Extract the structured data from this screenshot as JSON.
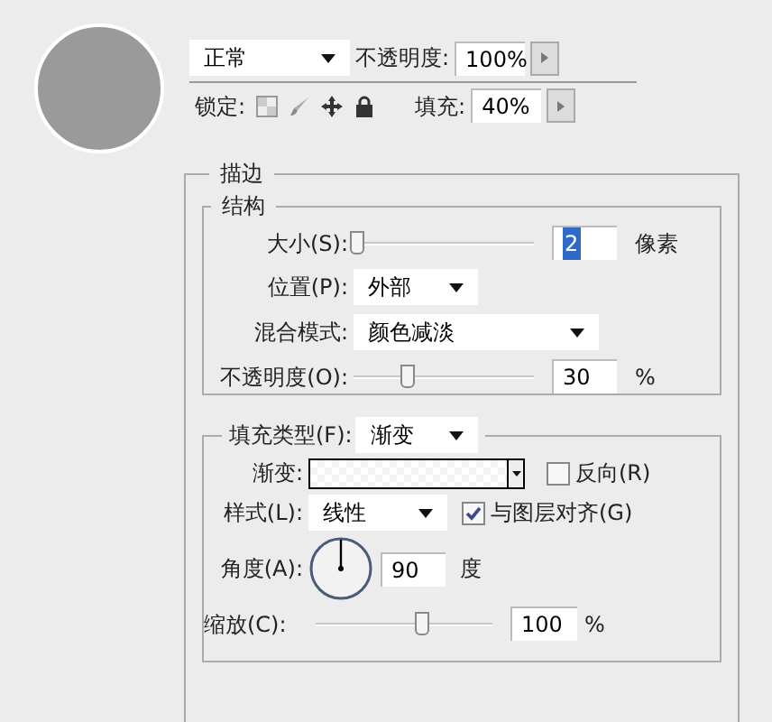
{
  "layers": {
    "blend_mode": "正常",
    "opacity_label": "不透明度:",
    "opacity": "100%",
    "lock_label": "锁定:",
    "fill_label": "填充:",
    "fill": "40%"
  },
  "stroke": {
    "title": "描边",
    "structure": {
      "title": "结构",
      "size": {
        "label": "大小(S):",
        "level": 0.02,
        "value": "2",
        "value_selected": true,
        "unit": "像素"
      },
      "position": {
        "label": "位置(P):",
        "value": "外部"
      },
      "blend_mode": {
        "label": "混合模式:",
        "value": "颜色减淡"
      },
      "opacity": {
        "label": "不透明度(O):",
        "level": 0.3,
        "value": "30",
        "value_selected": false,
        "unit": "%"
      }
    },
    "fill": {
      "type_label": "填充类型(F):",
      "type": "渐变",
      "gradient_label": "渐变:",
      "reverse": {
        "label": "反向(R)",
        "checked": false
      },
      "style_label": "样式(L):",
      "style": "线性",
      "align": {
        "label": "与图层对齐(G)",
        "checked": true
      },
      "angle_label": "角度(A):",
      "angle": "90",
      "angle_unit": "度",
      "scale": {
        "label": "缩放(C):",
        "level": 0.6,
        "value": "100",
        "value_selected": false,
        "unit": "%"
      }
    }
  }
}
